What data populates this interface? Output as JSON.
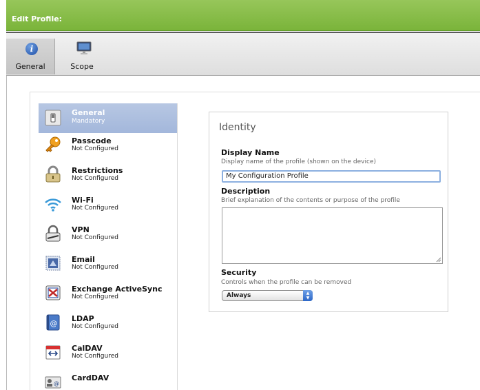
{
  "title_bar": {
    "title": "Edit Profile:"
  },
  "toolbar": {
    "items": [
      {
        "label": "General",
        "icon": "info-icon",
        "selected": true
      },
      {
        "label": "Scope",
        "icon": "monitor-icon",
        "selected": false
      }
    ]
  },
  "sidebar": {
    "items": [
      {
        "title": "General",
        "status": "Mandatory",
        "icon": "switch-icon",
        "selected": true
      },
      {
        "title": "Passcode",
        "status": "Not Configured",
        "icon": "key-icon"
      },
      {
        "title": "Restrictions",
        "status": "Not Configured",
        "icon": "padlock-icon"
      },
      {
        "title": "Wi-Fi",
        "status": "Not Configured",
        "icon": "wifi-icon"
      },
      {
        "title": "VPN",
        "status": "Not Configured",
        "icon": "vpn-lock-icon"
      },
      {
        "title": "Email",
        "status": "Not Configured",
        "icon": "email-stamp-icon"
      },
      {
        "title": "Exchange ActiveSync",
        "status": "Not Configured",
        "icon": "exchange-icon"
      },
      {
        "title": "LDAP",
        "status": "Not Configured",
        "icon": "address-book-icon"
      },
      {
        "title": "CalDAV",
        "status": "Not Configured",
        "icon": "calendar-icon"
      },
      {
        "title": "CardDAV",
        "status": "",
        "icon": "contacts-card-icon"
      }
    ]
  },
  "identity": {
    "title": "Identity",
    "display_name": {
      "label": "Display Name",
      "help": "Display name of the profile (shown on the device)",
      "value": "My Configuration Profile"
    },
    "description": {
      "label": "Description",
      "help": "Brief explanation of the contents or purpose of the profile",
      "value": ""
    },
    "security": {
      "label": "Security",
      "help": "Controls when the profile can be removed",
      "selected": "Always"
    }
  },
  "colors": {
    "title_bar": "#7ab43a",
    "selected_item": "#a3b7db",
    "focus_ring": "#8cb0e0"
  }
}
